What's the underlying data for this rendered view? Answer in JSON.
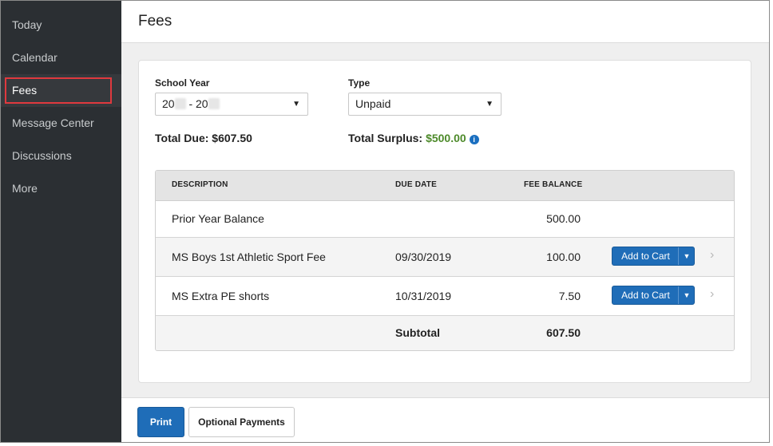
{
  "sidebar": {
    "items": [
      {
        "label": "Today"
      },
      {
        "label": "Calendar"
      },
      {
        "label": "Fees"
      },
      {
        "label": "Message Center"
      },
      {
        "label": "Discussions"
      },
      {
        "label": "More"
      }
    ],
    "active": "Fees"
  },
  "header": {
    "title": "Fees"
  },
  "filters": {
    "school_year": {
      "label": "School Year",
      "value_prefix": "20",
      "value_middle": " - 20"
    },
    "type": {
      "label": "Type",
      "value": "Unpaid"
    }
  },
  "totals": {
    "due_label": "Total Due: $607.50",
    "surplus_label": "Total Surplus:",
    "surplus_value": "$500.00"
  },
  "table": {
    "headers": {
      "description": "DESCRIPTION",
      "due_date": "DUE DATE",
      "fee_balance": "FEE BALANCE"
    },
    "rows": [
      {
        "description": "Prior Year Balance",
        "due_date": "",
        "balance": "500.00",
        "action": ""
      },
      {
        "description": "MS Boys 1st Athletic Sport Fee",
        "due_date": "09/30/2019",
        "balance": "100.00",
        "action": "Add to Cart"
      },
      {
        "description": "MS Extra PE shorts",
        "due_date": "10/31/2019",
        "balance": "7.50",
        "action": "Add to Cart"
      }
    ],
    "subtotal": {
      "label": "Subtotal",
      "value": "607.50"
    }
  },
  "footer": {
    "print_label": "Print",
    "optional_payments_label": "Optional Payments"
  },
  "colors": {
    "accent": "#1f6db8",
    "surplus": "#4d8a2a",
    "sidebar_bg": "#2b2f33",
    "highlight": "#e0393e"
  }
}
